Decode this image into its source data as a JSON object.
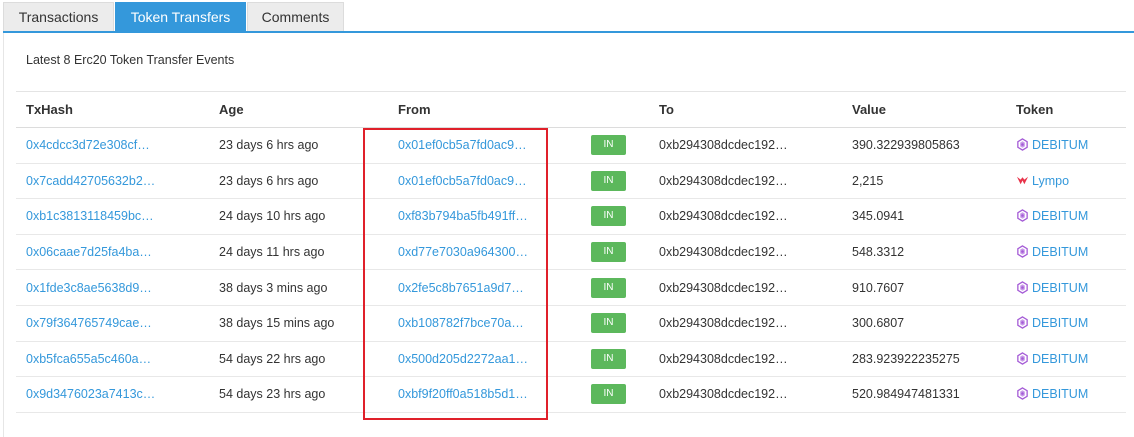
{
  "tabs": [
    {
      "label": "Transactions",
      "active": false
    },
    {
      "label": "Token Transfers",
      "active": true
    },
    {
      "label": "Comments",
      "active": false
    }
  ],
  "caption": "Latest 8 Erc20 Token Transfer Events",
  "table": {
    "headers": [
      "TxHash",
      "Age",
      "From",
      "",
      "To",
      "Value",
      "Token"
    ],
    "rows": [
      {
        "txhash": "0x4cdcc3d72e308cf…",
        "age": "23 days 6 hrs ago",
        "from": "0x01ef0cb5a7fd0ac9…",
        "direction": "IN",
        "to": "0xb294308dcdec192…",
        "value": "390.322939805863",
        "token": "DEBITUM",
        "token_icon": "debitum-icon"
      },
      {
        "txhash": "0x7cadd42705632b2…",
        "age": "23 days 6 hrs ago",
        "from": "0x01ef0cb5a7fd0ac9…",
        "direction": "IN",
        "to": "0xb294308dcdec192…",
        "value": "2,215",
        "token": "Lympo",
        "token_icon": "lympo-icon"
      },
      {
        "txhash": "0xb1c3813118459bc…",
        "age": "24 days 10 hrs ago",
        "from": "0xf83b794ba5fb491ff…",
        "direction": "IN",
        "to": "0xb294308dcdec192…",
        "value": "345.0941",
        "token": "DEBITUM",
        "token_icon": "debitum-icon"
      },
      {
        "txhash": "0x06caae7d25fa4ba…",
        "age": "24 days 11 hrs ago",
        "from": "0xd77e7030a964300…",
        "direction": "IN",
        "to": "0xb294308dcdec192…",
        "value": "548.3312",
        "token": "DEBITUM",
        "token_icon": "debitum-icon"
      },
      {
        "txhash": "0x1fde3c8ae5638d9…",
        "age": "38 days 3 mins ago",
        "from": "0x2fe5c8b7651a9d7…",
        "direction": "IN",
        "to": "0xb294308dcdec192…",
        "value": "910.7607",
        "token": "DEBITUM",
        "token_icon": "debitum-icon"
      },
      {
        "txhash": "0x79f364765749cae…",
        "age": "38 days 15 mins ago",
        "from": "0xb108782f7bce70a…",
        "direction": "IN",
        "to": "0xb294308dcdec192…",
        "value": "300.6807",
        "token": "DEBITUM",
        "token_icon": "debitum-icon"
      },
      {
        "txhash": "0xb5fca655a5c460a…",
        "age": "54 days 22 hrs ago",
        "from": "0x500d205d2272aa1…",
        "direction": "IN",
        "to": "0xb294308dcdec192…",
        "value": "283.923922235275",
        "token": "DEBITUM",
        "token_icon": "debitum-icon"
      },
      {
        "txhash": "0x9d3476023a7413c…",
        "age": "54 days 23 hrs ago",
        "from": "0xbf9f20ff0a518b5d1…",
        "direction": "IN",
        "to": "0xb294308dcdec192…",
        "value": "520.984947481331",
        "token": "DEBITUM",
        "token_icon": "debitum-icon"
      }
    ]
  },
  "colors": {
    "accent": "#3498db",
    "badge": "#5cb85c",
    "highlight": "#e0202a",
    "debitum": "#a45ad6",
    "lympo": "#e8334a"
  }
}
